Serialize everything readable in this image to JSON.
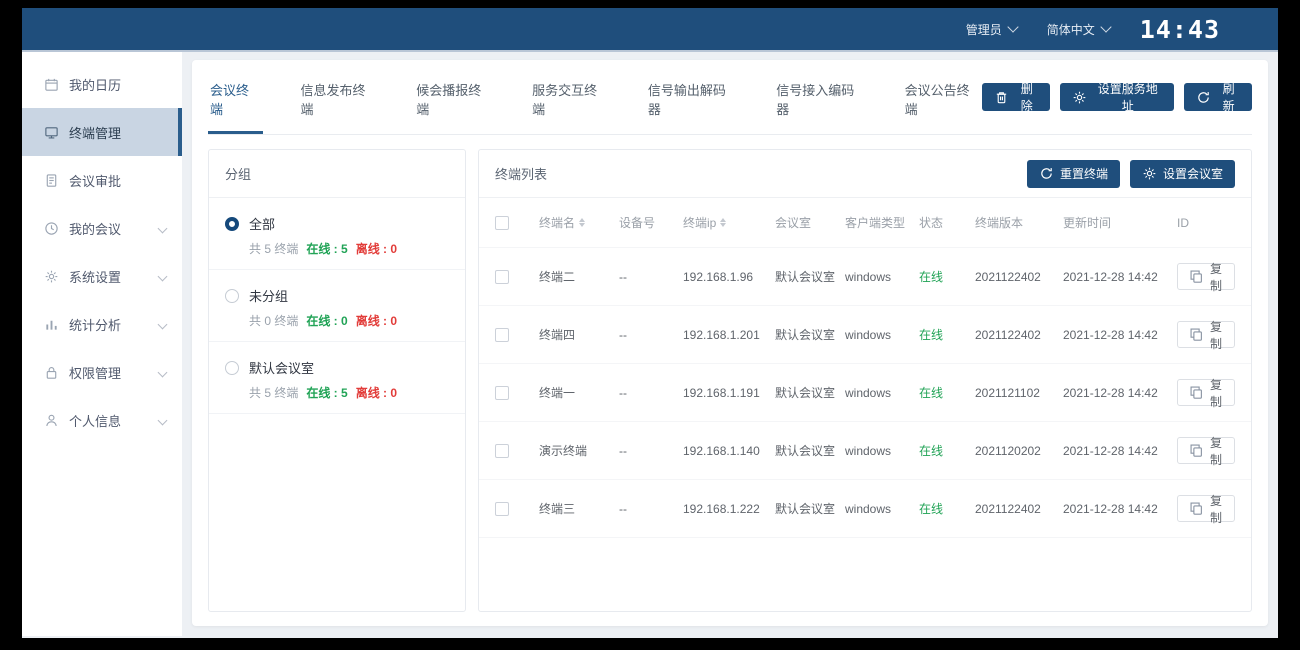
{
  "topbar": {
    "user": "管理员",
    "language": "简体中文",
    "clock": "14:43"
  },
  "sidebar": {
    "items": [
      {
        "label": "我的日历"
      },
      {
        "label": "终端管理"
      },
      {
        "label": "会议审批"
      },
      {
        "label": "我的会议"
      },
      {
        "label": "系统设置"
      },
      {
        "label": "统计分析"
      },
      {
        "label": "权限管理"
      },
      {
        "label": "个人信息"
      }
    ]
  },
  "tabs": {
    "items": [
      {
        "label": "会议终端"
      },
      {
        "label": "信息发布终端"
      },
      {
        "label": "候会播报终端"
      },
      {
        "label": "服务交互终端"
      },
      {
        "label": "信号输出解码器"
      },
      {
        "label": "信号接入编码器"
      },
      {
        "label": "会议公告终端"
      }
    ]
  },
  "toolbar": {
    "delete_label": "删除",
    "set_service_label": "设置服务地址",
    "refresh_label": "刷新"
  },
  "groups": {
    "title": "分组",
    "items": [
      {
        "name": "全部",
        "total": "共 5 终端",
        "online": "在线 : 5",
        "offline": "离线 : 0"
      },
      {
        "name": "未分组",
        "total": "共 0 终端",
        "online": "在线 : 0",
        "offline": "离线 : 0"
      },
      {
        "name": "默认会议室",
        "total": "共 5 终端",
        "online": "在线 : 5",
        "offline": "离线 : 0"
      }
    ]
  },
  "terminals": {
    "title": "终端列表",
    "reset_label": "重置终端",
    "set_room_label": "设置会议室",
    "copy_label": "复制",
    "columns": [
      "终端名",
      "设备号",
      "终端ip",
      "会议室",
      "客户端类型",
      "状态",
      "终端版本",
      "更新时间",
      "ID"
    ],
    "rows": [
      {
        "name": "终端二",
        "device": "--",
        "ip": "192.168.1.96",
        "room": "默认会议室",
        "client": "windows",
        "status": "在线",
        "version": "2021122402",
        "updated": "2021-12-28 14:42"
      },
      {
        "name": "终端四",
        "device": "--",
        "ip": "192.168.1.201",
        "room": "默认会议室",
        "client": "windows",
        "status": "在线",
        "version": "2021122402",
        "updated": "2021-12-28 14:42"
      },
      {
        "name": "终端一",
        "device": "--",
        "ip": "192.168.1.191",
        "room": "默认会议室",
        "client": "windows",
        "status": "在线",
        "version": "2021121102",
        "updated": "2021-12-28 14:42"
      },
      {
        "name": "演示终端",
        "device": "--",
        "ip": "192.168.1.140",
        "room": "默认会议室",
        "client": "windows",
        "status": "在线",
        "version": "2021120202",
        "updated": "2021-12-28 14:42"
      },
      {
        "name": "终端三",
        "device": "--",
        "ip": "192.168.1.222",
        "room": "默认会议室",
        "client": "windows",
        "status": "在线",
        "version": "2021122402",
        "updated": "2021-12-28 14:42"
      }
    ]
  },
  "colors": {
    "topbar": "#1f4e7c",
    "accent": "#2a5d8c",
    "sidebar_active_bg": "#c9d5e3",
    "online": "#21a356",
    "offline": "#e23c39"
  }
}
